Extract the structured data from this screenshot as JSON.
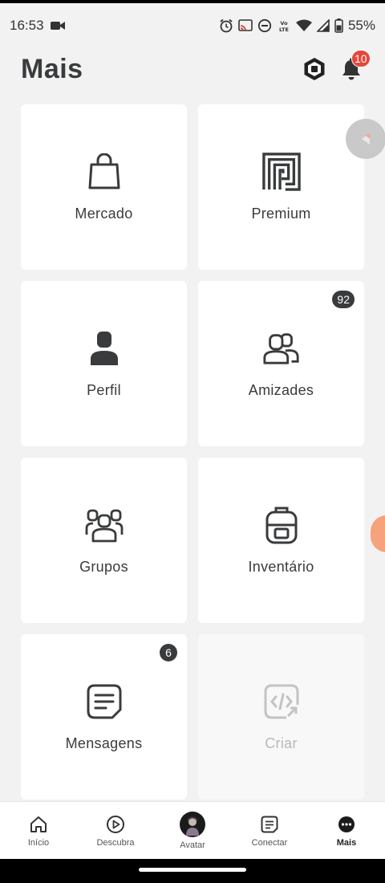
{
  "status_bar": {
    "time": "16:53",
    "battery": "55%",
    "lte_label": "Vo LTE"
  },
  "header": {
    "title": "Mais",
    "notification_count": "10"
  },
  "tiles": [
    {
      "label": "Mercado",
      "icon": "shopping-bag-icon"
    },
    {
      "label": "Premium",
      "icon": "premium-icon"
    },
    {
      "label": "Perfil",
      "icon": "profile-icon"
    },
    {
      "label": "Amizades",
      "icon": "friends-icon",
      "badge": "92"
    },
    {
      "label": "Grupos",
      "icon": "groups-icon"
    },
    {
      "label": "Inventário",
      "icon": "backpack-icon"
    },
    {
      "label": "Mensagens",
      "icon": "messages-icon",
      "badge": "6"
    },
    {
      "label": "Criar",
      "icon": "create-icon",
      "disabled": true
    }
  ],
  "bottom_nav": [
    {
      "label": "Início",
      "icon": "home-icon"
    },
    {
      "label": "Descubra",
      "icon": "play-icon"
    },
    {
      "label": "Avatar",
      "icon": "avatar-icon"
    },
    {
      "label": "Conectar",
      "icon": "chat-icon"
    },
    {
      "label": "Mais",
      "icon": "more-icon",
      "active": true
    }
  ],
  "colors": {
    "background": "#f2f2f2",
    "tile": "#ffffff",
    "text": "#393b3d",
    "notification_badge": "#e5473b",
    "count_badge": "#393b3d"
  }
}
